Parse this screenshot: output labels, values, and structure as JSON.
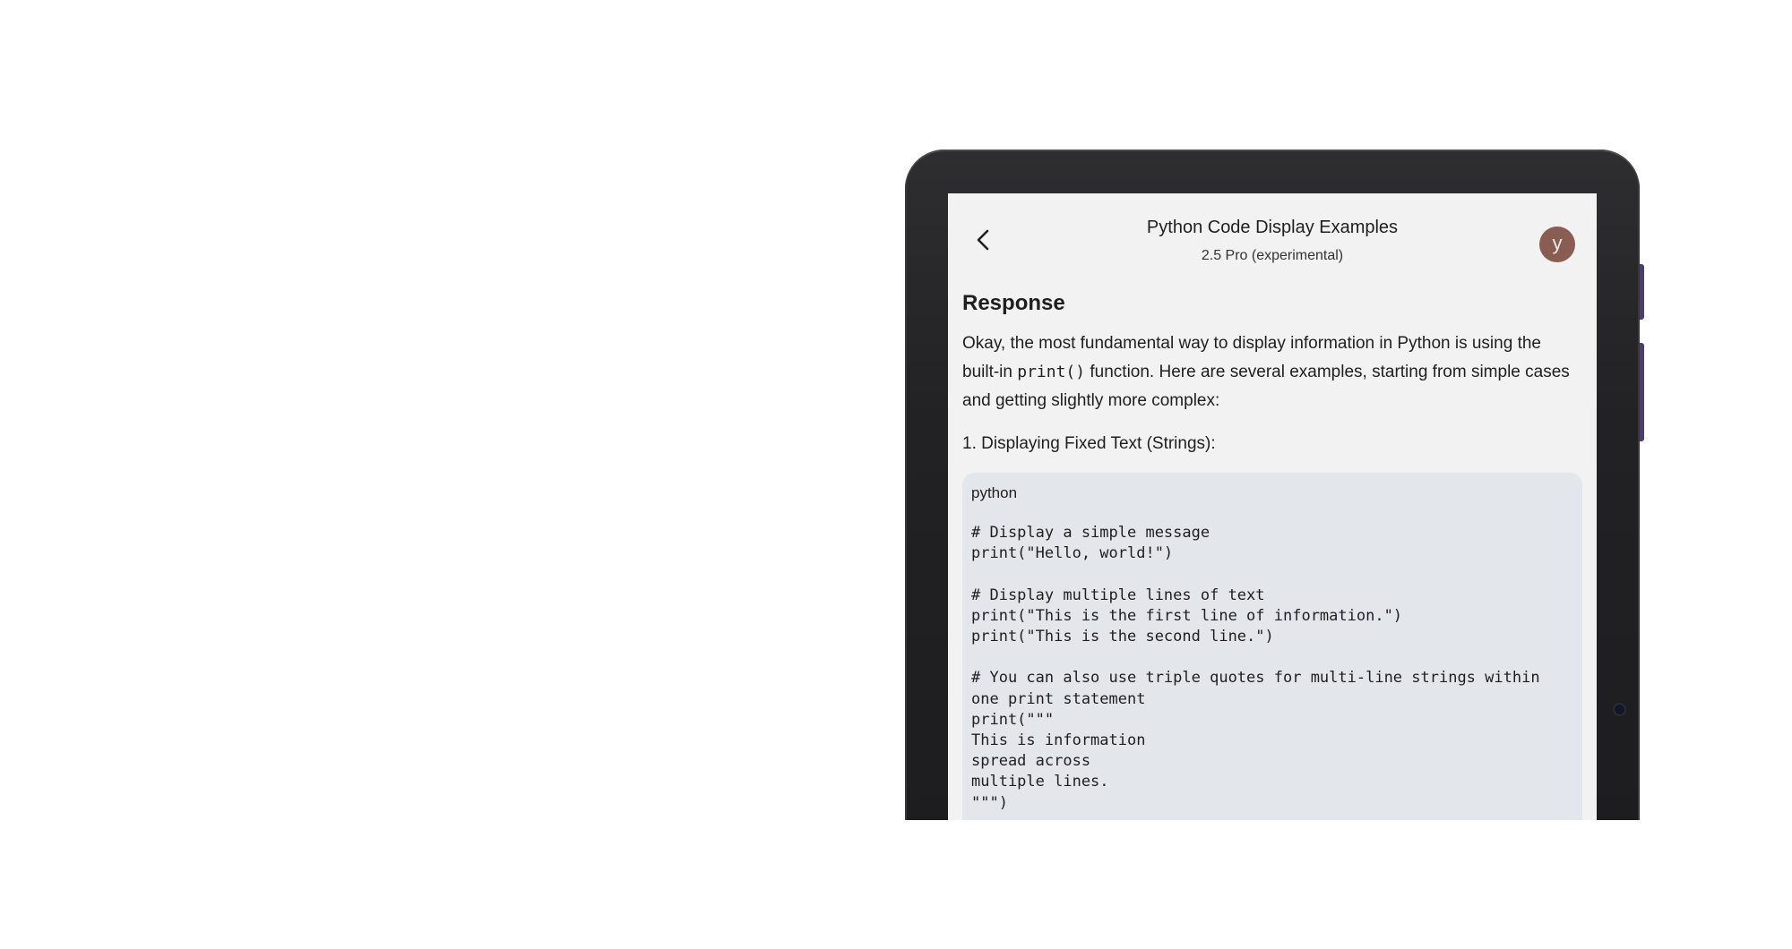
{
  "header": {
    "back_icon": "chevron-left-icon",
    "title": "Python Code Display Examples",
    "subtitle": "2.5 Pro (experimental)",
    "avatar_initial": "y",
    "avatar_color": "#8a5d52"
  },
  "response": {
    "heading": "Response",
    "intro_before_code": "Okay, the most fundamental way to display information in Python is using the built-in ",
    "intro_code": "print()",
    "intro_after_code": " function. Here are several examples, starting from simple cases and getting slightly more complex:",
    "step_1": "1. Displaying Fixed Text (Strings):",
    "code_block": {
      "language": "python",
      "code": "# Display a simple message\nprint(\"Hello, world!\")\n\n# Display multiple lines of text\nprint(\"This is the first line of information.\")\nprint(\"This is the second line.\")\n\n# You can also use triple quotes for multi-line strings within one print statement\nprint(\"\"\"\nThis is information\nspread across\nmultiple lines.\n\"\"\")"
    }
  },
  "colors": {
    "screen_background": "#f2f2f2",
    "code_background": "#e3e6ea",
    "device_frame": "#222224",
    "side_button": "#4a3f6b"
  }
}
